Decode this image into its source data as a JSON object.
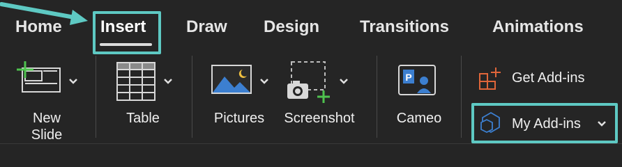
{
  "colors": {
    "background": "#252525",
    "highlight": "#5ec9c3",
    "arrow": "#5ec9c3",
    "plus_green": "#4ec24e",
    "addins_orange": "#e0663a",
    "addins_blue": "#3c7fd0"
  },
  "tabs": [
    {
      "label": "Home"
    },
    {
      "label": "Insert",
      "active": true
    },
    {
      "label": "Draw"
    },
    {
      "label": "Design"
    },
    {
      "label": "Transitions"
    },
    {
      "label": "Animations"
    }
  ],
  "ribbon": {
    "new_slide": {
      "label_line1": "New",
      "label_line2": "Slide",
      "icon": "new-slide-icon"
    },
    "table": {
      "label": "Table",
      "icon": "table-icon"
    },
    "pictures": {
      "label": "Pictures",
      "icon": "pictures-icon"
    },
    "screenshot": {
      "label": "Screenshot",
      "icon": "screenshot-icon"
    },
    "cameo": {
      "label": "Cameo",
      "icon": "cameo-icon"
    },
    "get_addins": {
      "label": "Get Add-ins",
      "icon": "get-addins-icon"
    },
    "my_addins": {
      "label": "My Add-ins",
      "icon": "my-addins-icon"
    }
  }
}
